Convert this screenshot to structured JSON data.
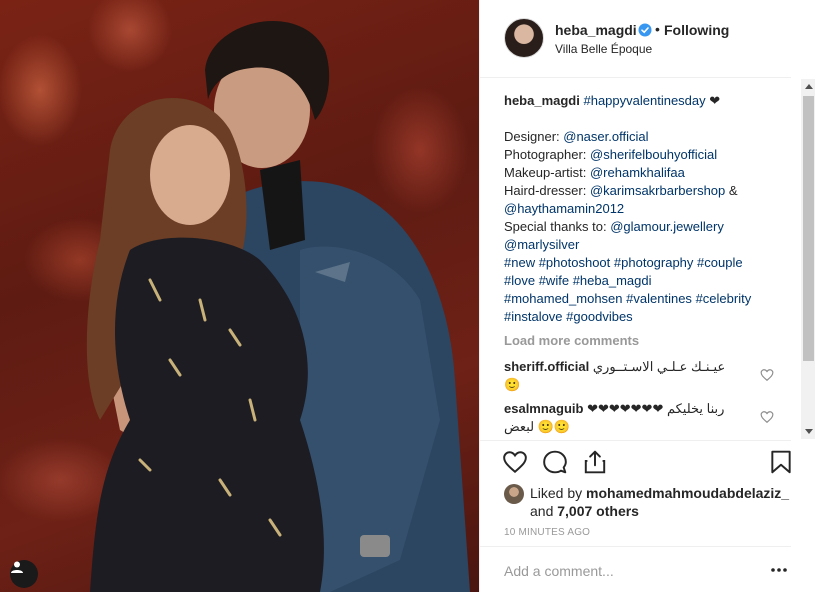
{
  "post": {
    "username": "heba_magdi",
    "separator": "•",
    "follow_status": "Following",
    "location": "Villa Belle Époque"
  },
  "caption": {
    "username": "heba_magdi",
    "hashtag_main": "#happyvalentinesday",
    "heart": "❤",
    "lines": [
      {
        "label": "Designer: ",
        "links": [
          "@naser.official"
        ]
      },
      {
        "label": "Photographer: ",
        "links": [
          "@sherifelbouhyofficial"
        ]
      },
      {
        "label": "Makeup-artist: ",
        "links": [
          "@rehamkhalifaa"
        ]
      },
      {
        "label": "Haird-dresser: ",
        "links": [
          "@karimsakrbarbershop"
        ],
        "suffix": " &"
      },
      {
        "label": "",
        "links": [
          "@haythamamin2012"
        ]
      },
      {
        "label": "Special thanks to: ",
        "links": [
          "@glamour.jewellery"
        ]
      },
      {
        "label": "",
        "links": [
          "@marlysilver"
        ]
      },
      {
        "label": "",
        "links": [
          "#new",
          "#photoshoot",
          "#photography",
          "#couple"
        ]
      },
      {
        "label": "",
        "links": [
          "#love",
          "#wife",
          "#heba_magdi"
        ]
      },
      {
        "label": "",
        "links": [
          "#mohamed_mohsen",
          "#valentines",
          "#celebrity"
        ]
      },
      {
        "label": "",
        "links": [
          "#instalove",
          "#goodvibes"
        ]
      }
    ]
  },
  "load_more": "Load more comments",
  "comments": [
    {
      "username": "sheriff.official",
      "text": "عيـنـك عـلـي الاسـتــوري",
      "text2": "🙂"
    },
    {
      "username": "esalmnaguib",
      "text": "❤❤❤❤❤❤❤ ربنا يخليكم",
      "text2": "لبعض 🙂🙂"
    }
  ],
  "likes": {
    "prefix": "Liked by ",
    "user": "mohamedmahmoudabdelaziz_",
    "middle": "and ",
    "count": "7,007 others"
  },
  "timestamp": "10 MINUTES AGO",
  "add_comment": {
    "placeholder": "Add a comment..."
  },
  "colors": {
    "link": "#003569",
    "verified": "#3897f0",
    "text": "#262626",
    "muted": "#999999"
  },
  "icons": [
    "heart-icon",
    "comment-icon",
    "share-icon",
    "bookmark-icon",
    "verified-icon",
    "more-options-icon",
    "user-tag-icon"
  ]
}
